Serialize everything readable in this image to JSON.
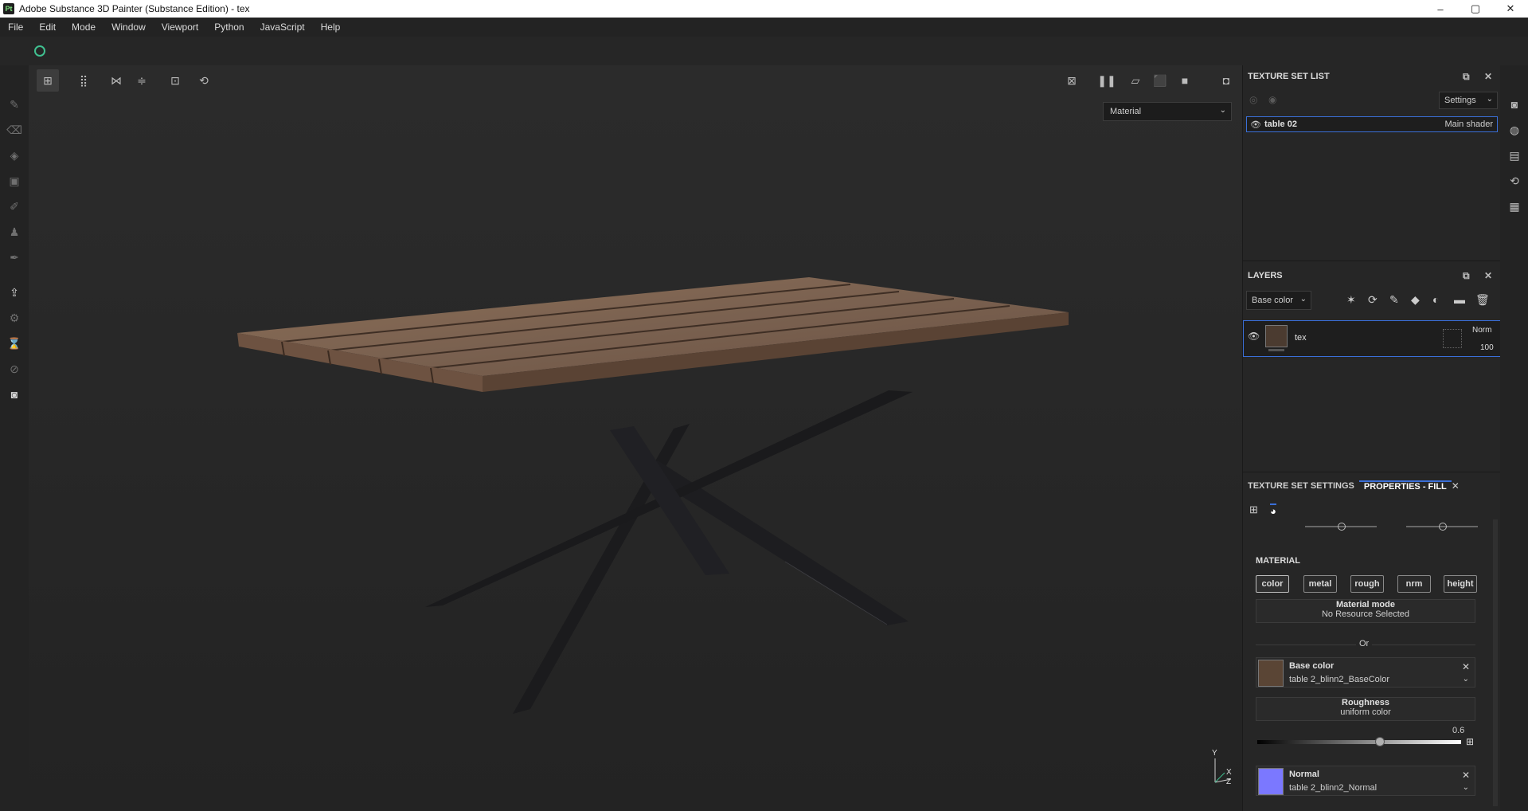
{
  "window": {
    "title": "Adobe Substance 3D Painter (Substance Edition) - tex",
    "logo": "Pt",
    "controls": [
      "–",
      "▢",
      "✕"
    ]
  },
  "menu": [
    "File",
    "Edit",
    "Mode",
    "Window",
    "Viewport",
    "Python",
    "JavaScript",
    "Help"
  ],
  "viewport": {
    "material_mode": "Material",
    "axis_labels": {
      "y": "Y",
      "x": "X",
      "z": "Z"
    }
  },
  "texture_set_list": {
    "title": "TEXTURE SET LIST",
    "settings_label": "Settings",
    "item": {
      "name": "table 02",
      "shader": "Main shader"
    }
  },
  "layers": {
    "title": "LAYERS",
    "channel": "Base color",
    "layer": {
      "name": "tex",
      "blend": "Norm",
      "opacity": "100"
    }
  },
  "properties": {
    "tabs": [
      "TEXTURE SET SETTINGS",
      "PROPERTIES - FILL"
    ],
    "material_label": "MATERIAL",
    "channels": [
      "color",
      "metal",
      "rough",
      "nrm",
      "height"
    ],
    "material_mode": {
      "title": "Material mode",
      "value": "No Resource Selected"
    },
    "or_label": "Or",
    "base_color": {
      "title": "Base color",
      "value": "table 2_blinn2_BaseColor"
    },
    "roughness": {
      "title": "Roughness",
      "value": "uniform color",
      "amount": "0.6"
    },
    "normal": {
      "title": "Normal",
      "value": "table 2_blinn2_Normal",
      "color": "#7b78ff"
    }
  }
}
